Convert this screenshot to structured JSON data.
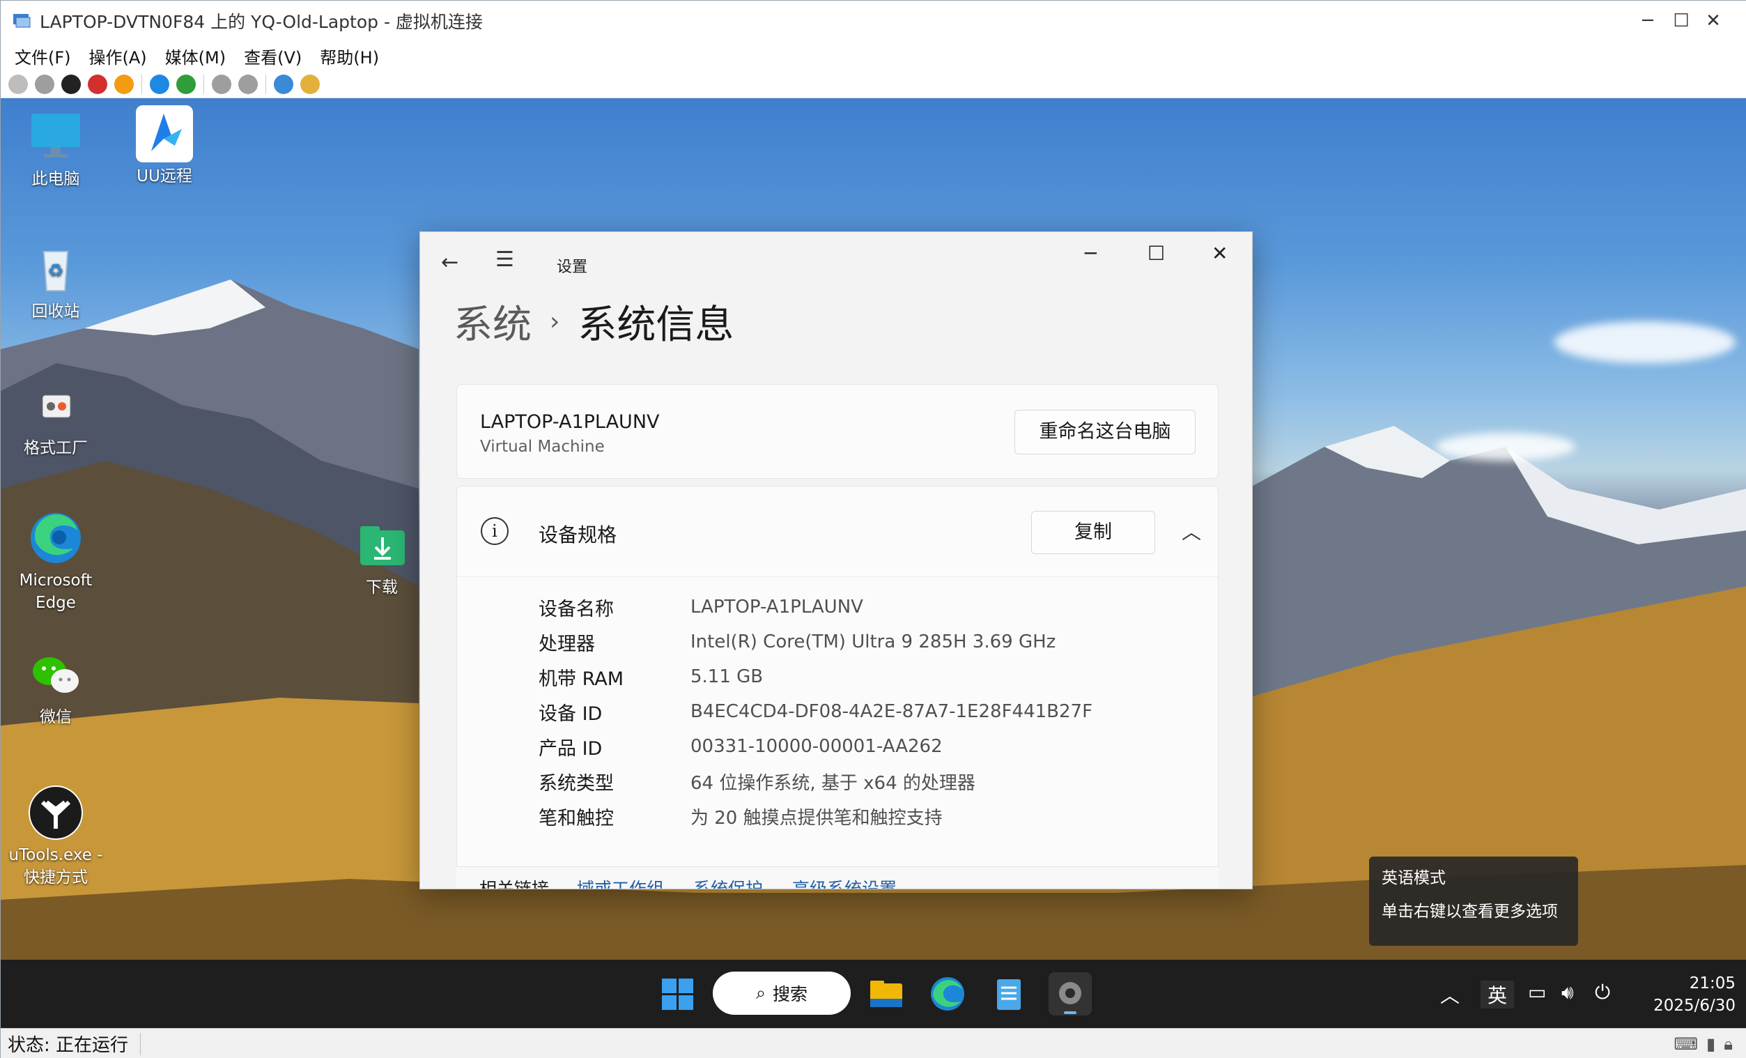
{
  "window": {
    "title": "LAPTOP-DVTN0F84 上的 YQ-Old-Laptop - 虚拟机连接",
    "controls": {
      "minimize": "─",
      "maximize": "☐",
      "close": "✕"
    }
  },
  "menu": [
    "文件(F)",
    "操作(A)",
    "媒体(M)",
    "查看(V)",
    "帮助(H)"
  ],
  "toolbar": [
    {
      "icon": "ctrl-alt-del-icon",
      "color": "#bdbdbd"
    },
    {
      "icon": "start-icon",
      "color": "#9e9e9e"
    },
    {
      "icon": "turn-off-icon",
      "color": "#222222"
    },
    {
      "icon": "shutdown-icon",
      "color": "#d32f2f"
    },
    {
      "icon": "save-icon",
      "color": "#f39c12"
    },
    {
      "icon": "pause-icon",
      "color": "#1e88e5"
    },
    {
      "icon": "resume-icon",
      "color": "#2e9d3a"
    },
    {
      "icon": "checkpoint-icon",
      "color": "#9e9e9e"
    },
    {
      "icon": "revert-icon",
      "color": "#9e9e9e"
    },
    {
      "icon": "enhanced-session-icon",
      "color": "#3a8ad6"
    },
    {
      "icon": "share-icon",
      "color": "#e3b13b"
    }
  ],
  "desktop": {
    "icons": [
      {
        "name": "this-pc",
        "label": "此电脑"
      },
      {
        "name": "uu-remote",
        "label": "UU远程"
      },
      {
        "name": "recycle-bin",
        "label": "回收站"
      },
      {
        "name": "format-factory",
        "label": "格式工厂"
      },
      {
        "name": "microsoft-edge",
        "label": "Microsoft Edge"
      },
      {
        "name": "downloads",
        "label": "下载"
      },
      {
        "name": "wechat",
        "label": "微信"
      },
      {
        "name": "utools",
        "label": "uTools.exe - 快捷方式"
      }
    ]
  },
  "settings": {
    "app_title": "设置",
    "breadcrumb_parent": "系统",
    "breadcrumb_sep": "›",
    "breadcrumb_current": "系统信息",
    "pc_name": "LAPTOP-A1PLAUNV",
    "pc_model": "Virtual Machine",
    "rename_button": "重命名这台电脑",
    "spec_title": "设备规格",
    "copy_button": "复制",
    "specs": [
      {
        "key": "设备名称",
        "value": "LAPTOP-A1PLAUNV"
      },
      {
        "key": "处理器",
        "value": "Intel(R) Core(TM) Ultra 9 285H   3.69 GHz"
      },
      {
        "key": "机带 RAM",
        "value": "5.11 GB"
      },
      {
        "key": "设备 ID",
        "value": "B4EC4CD4-DF08-4A2E-87A7-1E28F441B27F"
      },
      {
        "key": "产品 ID",
        "value": "00331-10000-00001-AA262"
      },
      {
        "key": "系统类型",
        "value": "64 位操作系统, 基于 x64 的处理器"
      },
      {
        "key": "笔和触控",
        "value": "为 20 触摸点提供笔和触控支持"
      }
    ],
    "related_label": "相关链接",
    "related_links": [
      "域或工作组",
      "系统保护",
      "高级系统设置"
    ]
  },
  "ime_tooltip": {
    "line1": "英语模式",
    "line2": "单击右键以查看更多选项"
  },
  "taskbar": {
    "search_label": "搜索",
    "ime_indicator": "英",
    "time": "21:05",
    "date": "2025/6/30"
  },
  "status": {
    "text": "状态: 正在运行"
  }
}
